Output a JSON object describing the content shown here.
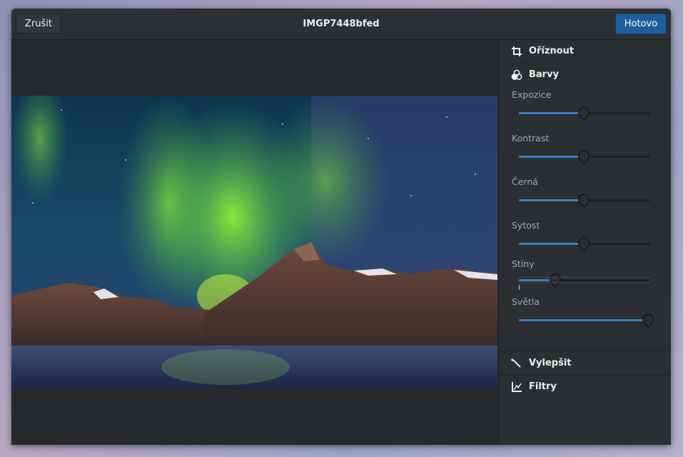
{
  "header": {
    "cancel_label": "Zrušit",
    "title": "IMGP7448bfed",
    "done_label": "Hotovo"
  },
  "sidebar": {
    "sections": {
      "crop": {
        "label": "Oříznout",
        "icon": "crop-icon"
      },
      "colors": {
        "label": "Barvy",
        "icon": "colors-icon"
      },
      "enhance": {
        "label": "Vylepšit",
        "icon": "magic-wand-icon"
      },
      "filters": {
        "label": "Filtry",
        "icon": "filters-icon"
      }
    },
    "sliders": [
      {
        "label": "Expozice",
        "value": 0.5
      },
      {
        "label": "Kontrast",
        "value": 0.5
      },
      {
        "label": "Černá",
        "value": 0.5
      },
      {
        "label": "Sytost",
        "value": 0.5
      },
      {
        "label": "Stíny",
        "value": 0.28
      },
      {
        "label": "Světla",
        "value": 1.0
      }
    ]
  },
  "colors": {
    "accent": "#3d7bc9",
    "done_button": "#215d9c",
    "window_bg": "#2b2f31"
  }
}
